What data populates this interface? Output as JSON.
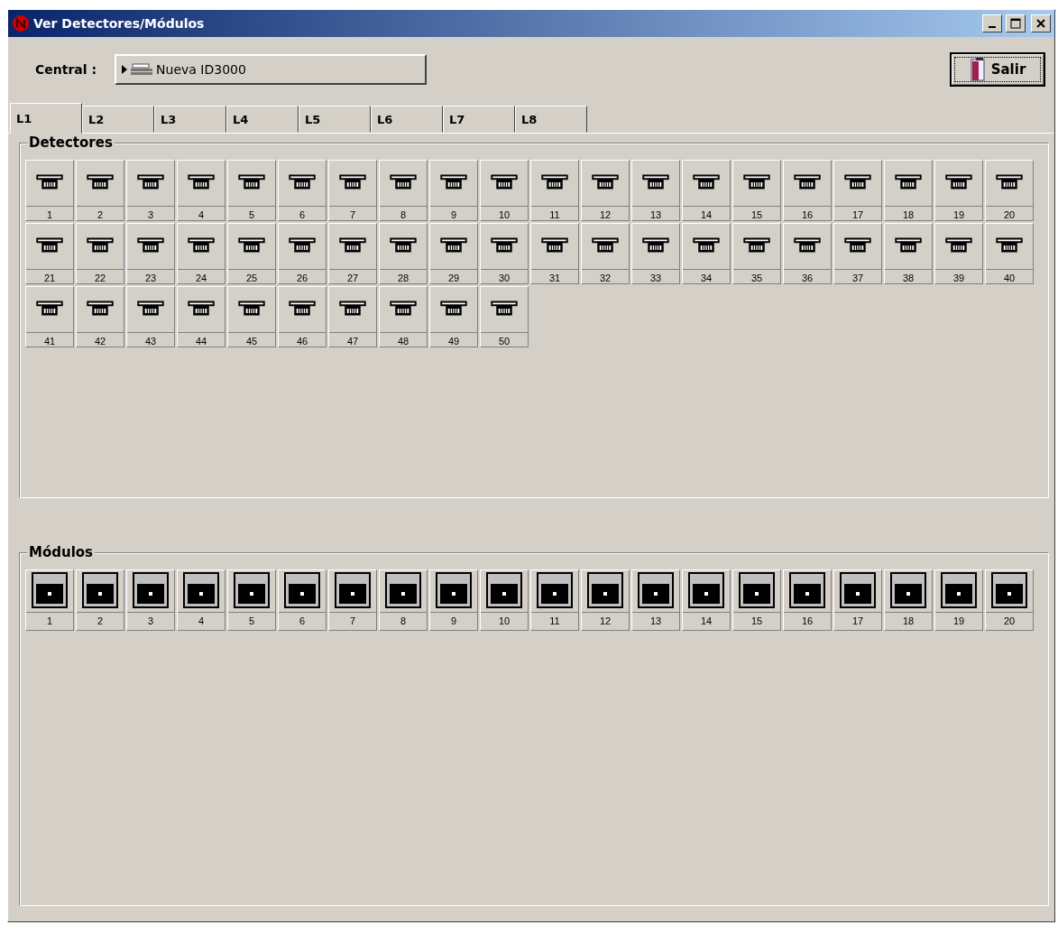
{
  "window": {
    "title": "Ver Detectores/Módulos"
  },
  "toolbar": {
    "central_label": "Central :",
    "central_value": "Nueva ID3000",
    "exit_button": "Salir"
  },
  "tabs": [
    {
      "label": "L1",
      "selected": true
    },
    {
      "label": "L2",
      "selected": false
    },
    {
      "label": "L3",
      "selected": false
    },
    {
      "label": "L4",
      "selected": false
    },
    {
      "label": "L5",
      "selected": false
    },
    {
      "label": "L6",
      "selected": false
    },
    {
      "label": "L7",
      "selected": false
    },
    {
      "label": "L8",
      "selected": false
    }
  ],
  "groups": [
    {
      "title": "Detectores",
      "kind": "detector",
      "items": [
        "1",
        "2",
        "3",
        "4",
        "5",
        "6",
        "7",
        "8",
        "9",
        "10",
        "11",
        "12",
        "13",
        "14",
        "15",
        "16",
        "17",
        "18",
        "19",
        "20",
        "21",
        "22",
        "23",
        "24",
        "25",
        "26",
        "27",
        "28",
        "29",
        "30",
        "31",
        "32",
        "33",
        "34",
        "35",
        "36",
        "37",
        "38",
        "39",
        "40",
        "41",
        "42",
        "43",
        "44",
        "45",
        "46",
        "47",
        "48",
        "49",
        "50"
      ]
    },
    {
      "title": "Módulos",
      "kind": "module",
      "items": [
        "1",
        "2",
        "3",
        "4",
        "5",
        "6",
        "7",
        "8",
        "9",
        "10",
        "11",
        "12",
        "13",
        "14",
        "15",
        "16",
        "17",
        "18",
        "19",
        "20"
      ]
    }
  ]
}
